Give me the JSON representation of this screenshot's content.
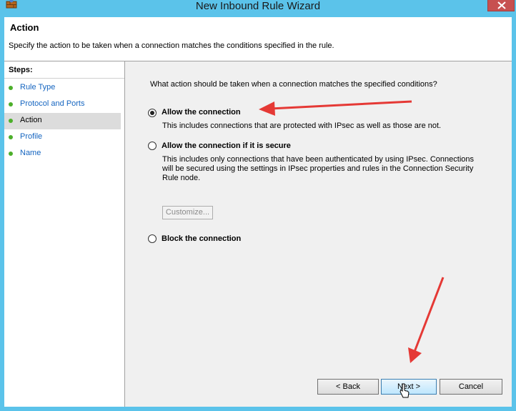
{
  "window": {
    "title": "New Inbound Rule Wizard"
  },
  "header": {
    "title": "Action",
    "description": "Specify the action to be taken when a connection matches the conditions specified in the rule."
  },
  "steps": {
    "title": "Steps:",
    "items": [
      {
        "label": "Rule Type",
        "active": false
      },
      {
        "label": "Protocol and Ports",
        "active": false
      },
      {
        "label": "Action",
        "active": true
      },
      {
        "label": "Profile",
        "active": false
      },
      {
        "label": "Name",
        "active": false
      }
    ]
  },
  "content": {
    "question": "What action should be taken when a connection matches the specified conditions?",
    "options": [
      {
        "label": "Allow the connection",
        "selected": true,
        "desc": [
          "This includes connections that are protected with IPsec as well as those are not."
        ]
      },
      {
        "label": "Allow the connection if it is secure",
        "selected": false,
        "desc": [
          "This includes only connections that have been authenticated by using IPsec.  Connections",
          "will be secured using the settings in IPsec properties and rules in the Connection Security",
          "Rule node."
        ]
      },
      {
        "label": "Block the connection",
        "selected": false,
        "desc": []
      }
    ],
    "customize_label": "Customize..."
  },
  "buttons": {
    "back": "< Back",
    "next": "Next >",
    "cancel": "Cancel"
  },
  "colors": {
    "titlebar": "#5bc3ea",
    "close": "#c75050",
    "step_dot": "#4caf2a",
    "link": "#1565c0",
    "annotation": "#e53935"
  }
}
